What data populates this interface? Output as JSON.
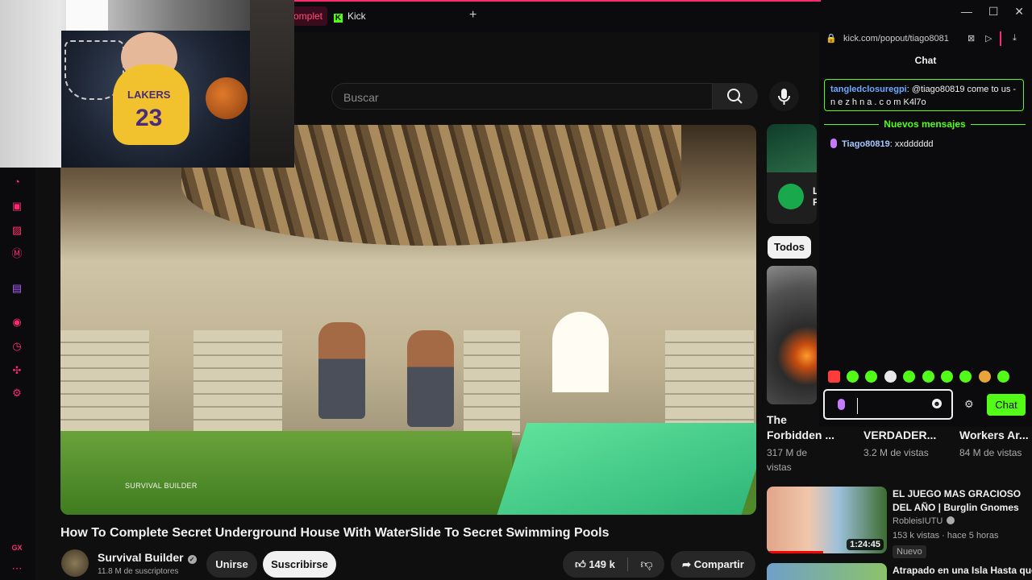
{
  "browser": {
    "tabs": [
      {
        "label": "omplet"
      },
      {
        "label": "Kick"
      }
    ],
    "new_tab": "+",
    "address": "kick.com/popout/tiago8081",
    "window_controls": [
      "—",
      "☐",
      "✕"
    ]
  },
  "webcam_overlay": {
    "jersey_team": "LAKERS",
    "jersey_number": "23"
  },
  "search": {
    "placeholder": "Buscar"
  },
  "video": {
    "watermark": "SURVIVAL BUILDER",
    "title": "How To Complete Secret Underground House With WaterSlide To Secret Swimming Pools"
  },
  "channel": {
    "name": "Survival Builder",
    "subscribers": "11.8 M de suscriptores"
  },
  "actions": {
    "join": "Unirse",
    "subscribe": "Suscribirse",
    "likes": "149 k",
    "share": "Compartir"
  },
  "recommendations": {
    "ad": {
      "text_1": "L",
      "text_2": "F"
    },
    "chip_all": "Todos",
    "shorts": [
      {
        "title_line1": "The",
        "title_line2": "Forbidden ...",
        "views_line1": "317 M de",
        "views_line2": "vistas"
      },
      {
        "title_line2": "VERDADER...",
        "views_line1": "3.2 M de vistas"
      },
      {
        "title_line2": "Workers Ar...",
        "views_line1": "84 M de vistas"
      }
    ],
    "videos": [
      {
        "title": "EL JUEGO MAS GRACIOSO DEL AÑO | Burglin Gnomes",
        "channel": "RobleisIUTU",
        "meta": "153 k vistas · hace 5 horas",
        "badge": "Nuevo",
        "duration": "1:24:45"
      },
      {
        "title": "Atrapado en una Isla Hasta que"
      }
    ]
  },
  "chat": {
    "header": "Chat",
    "pinned": {
      "user": "tangledclosuregpi",
      "text": ": @tiago80819 come to us - n e z h n a . c o m K4l7o"
    },
    "new_messages_label": "Nuevos mensajes",
    "messages": [
      {
        "user": "Tiago80819",
        "text": ": xxdddddd"
      }
    ],
    "send_label": "Chat",
    "accent": "#53fc18"
  },
  "colors": {
    "kick_green": "#53fc18",
    "browser_accent": "#ff2a6d",
    "youtube_red": "#ff0000"
  }
}
